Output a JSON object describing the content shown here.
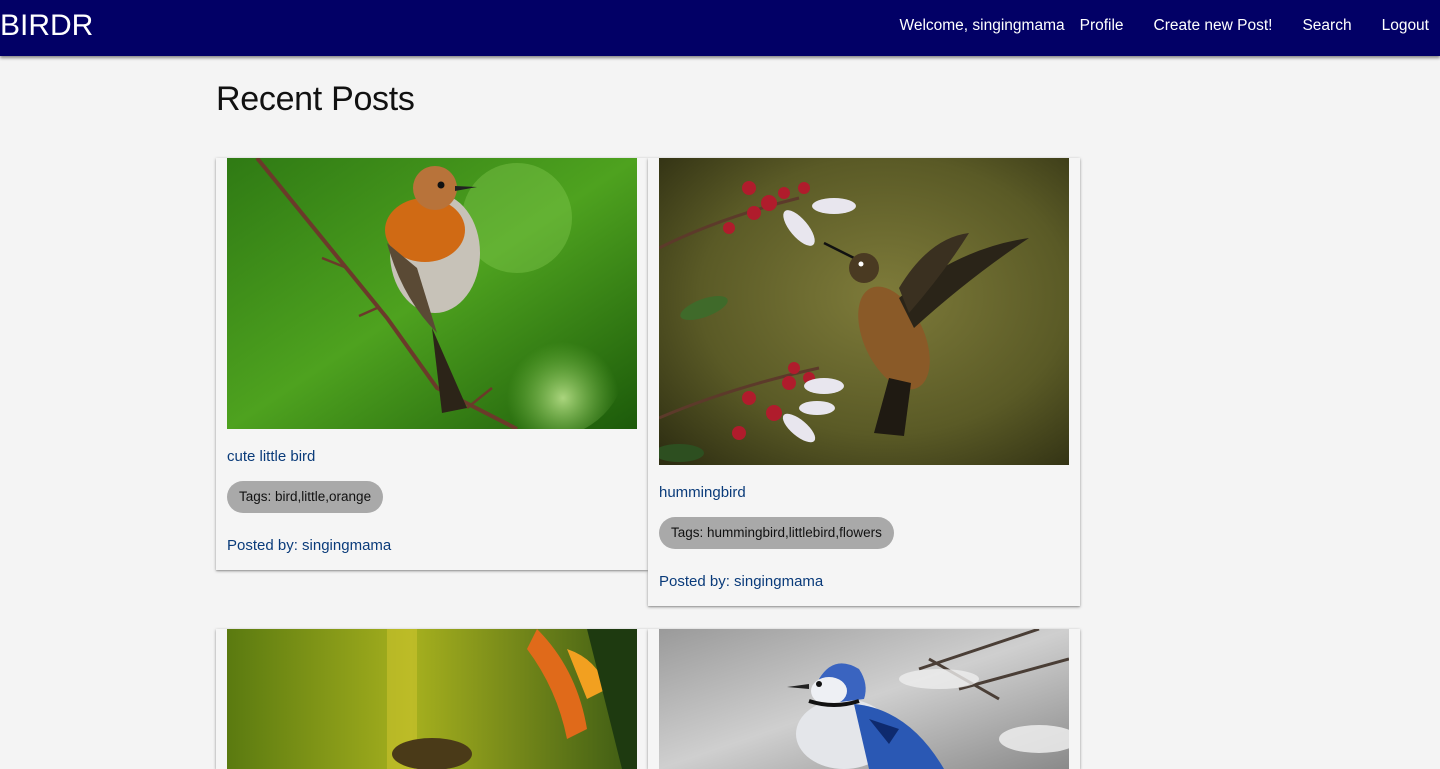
{
  "nav": {
    "brand": "BIRDR",
    "welcome": "Welcome, singingmama",
    "links": [
      "Profile",
      "Create new Post!",
      "Search",
      "Logout"
    ]
  },
  "page": {
    "title": "Recent Posts"
  },
  "posts": [
    {
      "title": "cute little bird",
      "tags": "Tags: bird,little,orange",
      "posted_by": "Posted by: singingmama"
    },
    {
      "title": "hummingbird",
      "tags": "Tags: hummingbird,littlebird,flowers",
      "posted_by": "Posted by: singingmama"
    },
    {
      "title": "",
      "tags": "",
      "posted_by": ""
    },
    {
      "title": "",
      "tags": "",
      "posted_by": ""
    }
  ],
  "colors": {
    "navbar": "#020066",
    "link": "#0a3b7a",
    "tag_pill": "#a9a9a9",
    "background": "#f4f4f4"
  }
}
